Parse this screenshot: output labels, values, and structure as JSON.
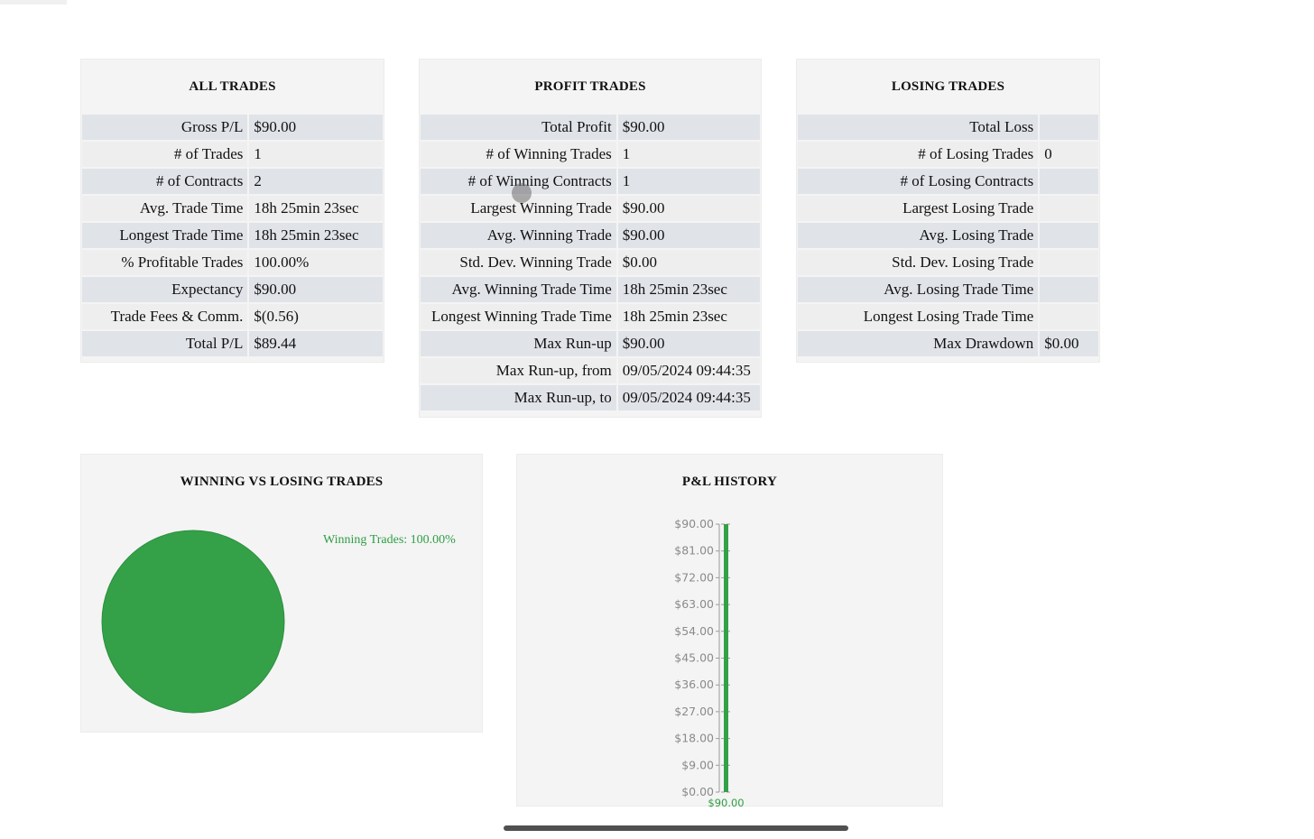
{
  "all_trades": {
    "title": "ALL TRADES",
    "rows": [
      {
        "label": "Gross P/L",
        "value": "$90.00"
      },
      {
        "label": "# of Trades",
        "value": "1"
      },
      {
        "label": "# of Contracts",
        "value": "2"
      },
      {
        "label": "Avg. Trade Time",
        "value": "18h 25min 23sec"
      },
      {
        "label": "Longest Trade Time",
        "value": "18h 25min 23sec"
      },
      {
        "label": "% Profitable Trades",
        "value": "100.00%"
      },
      {
        "label": "Expectancy",
        "value": "$90.00"
      },
      {
        "label": "Trade Fees & Comm.",
        "value": "$(0.56)"
      },
      {
        "label": "Total P/L",
        "value": "$89.44"
      }
    ]
  },
  "profit_trades": {
    "title": "PROFIT TRADES",
    "rows": [
      {
        "label": "Total Profit",
        "value": "$90.00"
      },
      {
        "label": "# of Winning Trades",
        "value": "1"
      },
      {
        "label": "# of Winning Contracts",
        "value": "1"
      },
      {
        "label": "Largest Winning Trade",
        "value": "$90.00"
      },
      {
        "label": "Avg. Winning Trade",
        "value": "$90.00"
      },
      {
        "label": "Std. Dev. Winning Trade",
        "value": "$0.00"
      },
      {
        "label": "Avg. Winning Trade Time",
        "value": "18h 25min 23sec"
      },
      {
        "label": "Longest Winning Trade Time",
        "value": "18h 25min 23sec"
      },
      {
        "label": "Max Run-up",
        "value": "$90.00"
      },
      {
        "label": "Max Run-up, from",
        "value": "09/05/2024 09:44:35"
      },
      {
        "label": "Max Run-up, to",
        "value": "09/05/2024 09:44:35"
      }
    ]
  },
  "losing_trades": {
    "title": "LOSING TRADES",
    "rows": [
      {
        "label": "Total Loss",
        "value": ""
      },
      {
        "label": "# of Losing Trades",
        "value": "0"
      },
      {
        "label": "# of Losing Contracts",
        "value": ""
      },
      {
        "label": "Largest Losing Trade",
        "value": ""
      },
      {
        "label": "Avg. Losing Trade",
        "value": ""
      },
      {
        "label": "Std. Dev. Losing Trade",
        "value": ""
      },
      {
        "label": "Avg. Losing Trade Time",
        "value": ""
      },
      {
        "label": "Longest Losing Trade Time",
        "value": ""
      },
      {
        "label": "Max Drawdown",
        "value": "$0.00"
      }
    ]
  },
  "colors": {
    "win_green": "#34a148",
    "table_row_odd": "#e0e3e8",
    "table_row_even": "#eeeeee",
    "panel_bg": "#f4f4f4"
  },
  "chart_data": [
    {
      "type": "pie",
      "title": "WINNING VS LOSING TRADES",
      "slices": [
        {
          "label": "Winning Trades: 100.00%",
          "value": 100,
          "color": "#34a148"
        }
      ],
      "legend_position": "top-right"
    },
    {
      "type": "bar",
      "title": "P&L HISTORY",
      "categories": [
        "$90.00"
      ],
      "values": [
        90
      ],
      "bar_color": "#34a148",
      "ylim": [
        0,
        90
      ],
      "yticks": [
        "$0.00",
        "$9.00",
        "$18.00",
        "$27.00",
        "$36.00",
        "$45.00",
        "$54.00",
        "$63.00",
        "$72.00",
        "$81.00",
        "$90.00"
      ],
      "data_labels": [
        "$90.00"
      ],
      "grid": false
    }
  ]
}
